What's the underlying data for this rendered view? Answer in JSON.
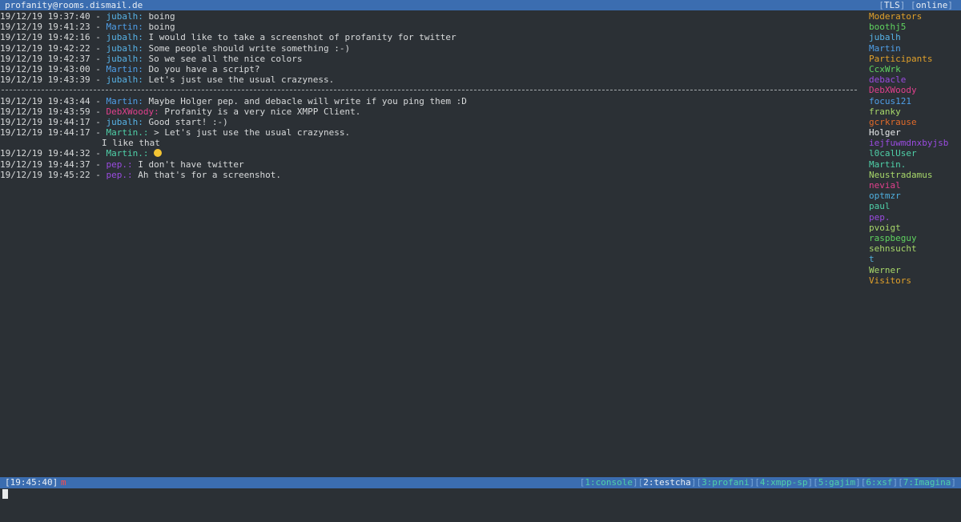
{
  "titlebar": {
    "jid": "profanity@rooms.dismail.de",
    "encryption": "TLS",
    "presence": "online"
  },
  "messages": [
    {
      "ts": "19/12/19 19:37:40",
      "nick": "jubalh",
      "color": "#57b2e6",
      "text": "boing"
    },
    {
      "ts": "19/12/19 19:41:23",
      "nick": "Martin",
      "color": "#4f9fe8",
      "text": "boing"
    },
    {
      "ts": "19/12/19 19:42:16",
      "nick": "jubalh",
      "color": "#57b2e6",
      "text": "I would like to take a screenshot of profanity for twitter"
    },
    {
      "ts": "19/12/19 19:42:22",
      "nick": "jubalh",
      "color": "#57b2e6",
      "text": "Some people should write something :-)"
    },
    {
      "ts": "19/12/19 19:42:37",
      "nick": "jubalh",
      "color": "#57b2e6",
      "text": "So we see all the nice colors"
    },
    {
      "ts": "19/12/19 19:43:00",
      "nick": "Martin",
      "color": "#4f9fe8",
      "text": "Do you have a script?"
    },
    {
      "ts": "19/12/19 19:43:39",
      "nick": "jubalh",
      "color": "#57b2e6",
      "text": "Let's just use the usual crazyness."
    },
    {
      "ts": "",
      "nick": "",
      "color": "",
      "text": "",
      "divider": true
    },
    {
      "ts": "19/12/19 19:43:44",
      "nick": "Martin",
      "color": "#4f9fe8",
      "text": "Maybe Holger pep. and debacle will write if you ping them :D"
    },
    {
      "ts": "19/12/19 19:43:59",
      "nick": "DebXWoody",
      "color": "#e0408c",
      "text": "Profanity is a very nice XMPP Client."
    },
    {
      "ts": "19/12/19 19:44:17",
      "nick": "jubalh",
      "color": "#57b2e6",
      "text": "Good start! :-)"
    },
    {
      "ts": "19/12/19 19:44:17",
      "nick": "Martin.",
      "color": "#4fd0a8",
      "text": "> Let's just use the usual crazyness."
    },
    {
      "ts": "",
      "nick": "",
      "color": "",
      "text": "I like that",
      "continuation": true
    },
    {
      "ts": "19/12/19 19:44:32",
      "nick": "Martin.",
      "color": "#4fd0a8",
      "text": "",
      "emoji": true
    },
    {
      "ts": "19/12/19 19:44:37",
      "nick": "pep.",
      "color": "#9a4be0",
      "text": "I don't have twitter"
    },
    {
      "ts": "19/12/19 19:45:22",
      "nick": "pep.",
      "color": "#9a4be0",
      "text": "Ah that's for a screenshot."
    }
  ],
  "roster": [
    {
      "name": "Moderators",
      "color": "#e0a02a"
    },
    {
      "name": "boothj5",
      "color": "#5fd35f"
    },
    {
      "name": "jubalh",
      "color": "#57b2e6"
    },
    {
      "name": "Martin",
      "color": "#4f9fe8"
    },
    {
      "name": "Participants",
      "color": "#e0a02a"
    },
    {
      "name": "CcxWrk",
      "color": "#5fd35f"
    },
    {
      "name": "debacle",
      "color": "#9a4be0"
    },
    {
      "name": "DebXWoody",
      "color": "#e0408c"
    },
    {
      "name": "focus121",
      "color": "#4f9fe8"
    },
    {
      "name": "franky",
      "color": "#a8d86a"
    },
    {
      "name": "gcrkrause",
      "color": "#e06a2a"
    },
    {
      "name": "Holger",
      "color": "#e8eaeb"
    },
    {
      "name": "iejfuwmdnxbyjsb",
      "color": "#9a4be0"
    },
    {
      "name": "l0calUser",
      "color": "#4fd0a8"
    },
    {
      "name": "Martin.",
      "color": "#4fd0a8"
    },
    {
      "name": "Neustradamus",
      "color": "#a8d86a"
    },
    {
      "name": "nevial",
      "color": "#e0408c"
    },
    {
      "name": "optmzr",
      "color": "#4fb0e0"
    },
    {
      "name": "paul",
      "color": "#4fd0a8"
    },
    {
      "name": "pep.",
      "color": "#9a4be0"
    },
    {
      "name": "pvoigt",
      "color": "#a8d86a"
    },
    {
      "name": "raspbeguy",
      "color": "#5fd35f"
    },
    {
      "name": "sehnsucht",
      "color": "#a8d86a"
    },
    {
      "name": "t",
      "color": "#4fb0e0"
    },
    {
      "name": "Werner",
      "color": "#a8d86a"
    },
    {
      "name": "Visitors",
      "color": "#e0a02a"
    }
  ],
  "statusbar": {
    "time": "19:45:40",
    "activity": "m",
    "windows": [
      {
        "label": "1:console",
        "color": "#4fd0a8"
      },
      {
        "label": "2:testcha",
        "color": "#e8eef5"
      },
      {
        "label": "3:profani",
        "color": "#4fd0a8"
      },
      {
        "label": "4:xmpp-sp",
        "color": "#4fd0a8"
      },
      {
        "label": "5:gajim",
        "color": "#4fd0a8"
      },
      {
        "label": "6:xsf",
        "color": "#4fd0a8"
      },
      {
        "label": "7:Imagina",
        "color": "#4fd0a8"
      }
    ]
  }
}
